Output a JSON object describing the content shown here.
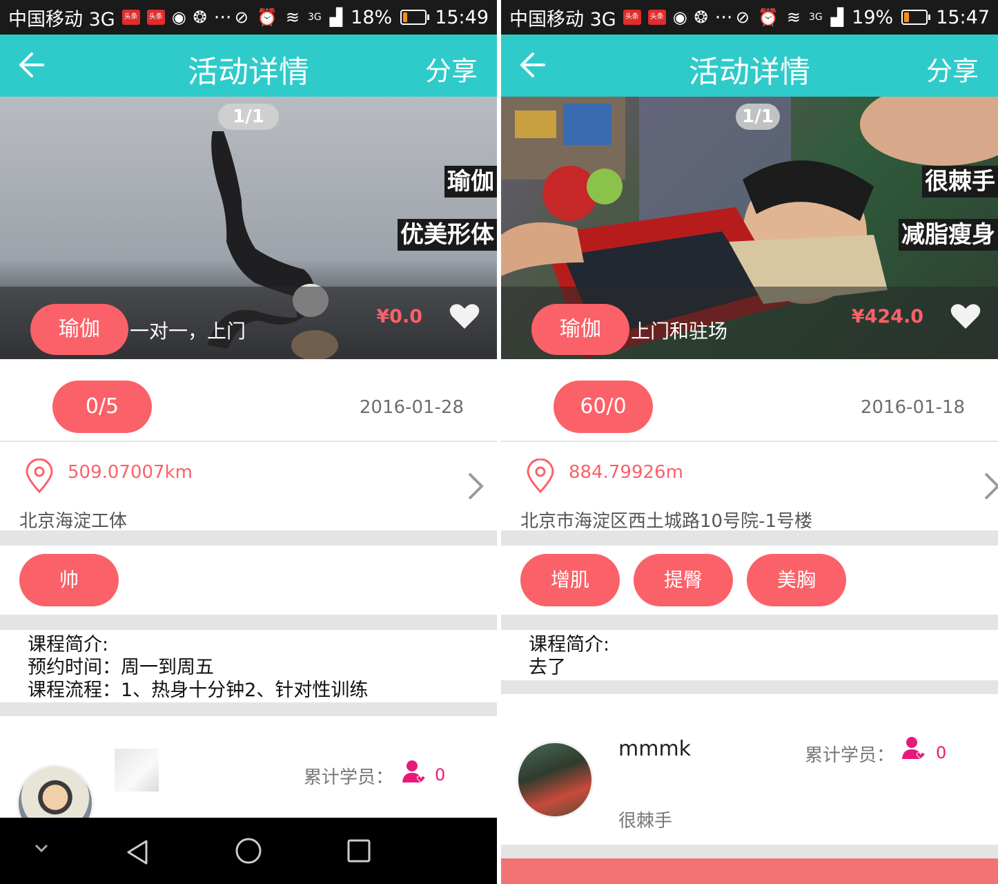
{
  "left": {
    "status": {
      "carrier": "中国移动 3G",
      "badge1": "头条",
      "badge2": "头条",
      "dots": "···",
      "net": "3G",
      "battery": "18%",
      "battery_level": 0.18,
      "time": "15:49"
    },
    "app_bar": {
      "title": "活动详情",
      "share": "分享"
    },
    "hero": {
      "counter": "1/1",
      "tags": [
        "瑜伽",
        "优美形体"
      ],
      "category": "瑜伽",
      "description": "一对一，上门",
      "price": "¥0.0"
    },
    "count": "0/5",
    "date": "2016-01-28",
    "distance": "509.07007km",
    "address": "北京海淀工体",
    "feature_tags": [
      "帅"
    ],
    "intro": [
      "课程简介:",
      "预约时间：周一到周五",
      "课程流程：1、热身十分钟2、针对性训练"
    ],
    "teacher": {
      "students_label": "累计学员：",
      "students_count": "0"
    }
  },
  "right": {
    "status": {
      "carrier": "中国移动 3G",
      "badge1": "头条",
      "badge2": "头条",
      "dots": "···",
      "net": "3G",
      "battery": "19%",
      "battery_level": 0.19,
      "time": "15:47"
    },
    "app_bar": {
      "title": "活动详情",
      "share": "分享"
    },
    "hero": {
      "counter": "1/1",
      "tags": [
        "很棘手",
        "减脂瘦身"
      ],
      "category": "瑜伽",
      "description": "上门和驻场",
      "price": "¥424.0"
    },
    "count": "60/0",
    "date": "2016-01-18",
    "distance": "884.79926m",
    "address": "北京市海淀区西土城路10号院-1号楼",
    "feature_tags": [
      "增肌",
      "提臀",
      "美胸"
    ],
    "intro": [
      "课程简介:",
      "去了"
    ],
    "teacher": {
      "name": "mmmk",
      "subtitle": "很棘手",
      "students_label": "累计学员：",
      "students_count": "0"
    }
  },
  "colors": {
    "teal": "#2ecbca",
    "accent": "#fb6168",
    "students": "#e8197a"
  }
}
